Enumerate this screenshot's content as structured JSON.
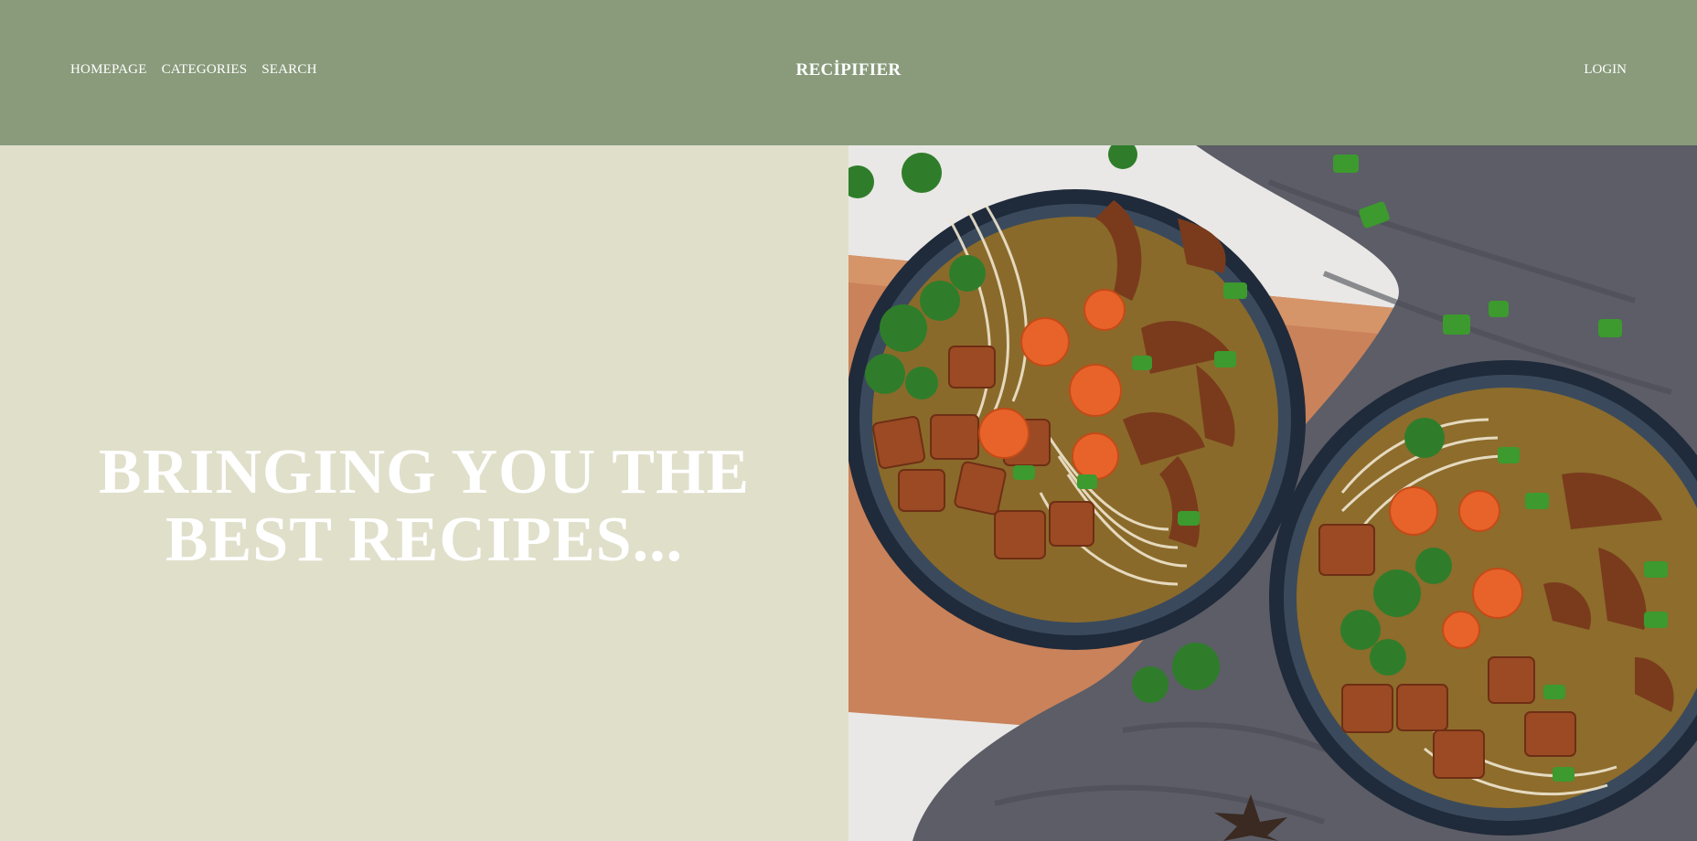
{
  "nav": {
    "items": [
      "HOMEPAGE",
      "CATEGORIES",
      "SEARCH"
    ],
    "brand": "RECİPIFIER",
    "login": "LOGIN"
  },
  "hero": {
    "title_line1": "BRINGING YOU THE",
    "title_line2": "BEST RECIPES...",
    "image_alt": "two bowls of noodle soup with tofu, mushrooms, carrots and greens"
  },
  "colors": {
    "header_bg": "#899b7b",
    "hero_left_bg": "#e0dfca",
    "text": "#ffffff"
  }
}
